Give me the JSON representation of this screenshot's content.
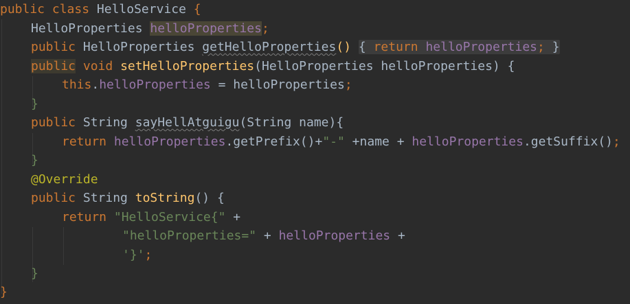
{
  "editor": {
    "class_decl": {
      "kw_public": "public",
      "kw_class": "class",
      "name": "HelloService",
      "brace_open": " {"
    },
    "field": {
      "type": "HelloProperties",
      "name": "helloProperties",
      "semi": ";"
    },
    "getter": {
      "kw_public": "public",
      "type": "HelloProperties",
      "name": "getHelloProperties",
      "parens": "()",
      "brace_open": "{",
      "kw_return": "return",
      "field": "helloProperties",
      "semi": ";",
      "brace_close": "}"
    },
    "setter": {
      "kw_public": "public",
      "kw_void": "void",
      "name": "setHelloProperties",
      "params": "(HelloProperties helloProperties) {",
      "kw_this": "this",
      "dot": ".",
      "field": "helloProperties",
      "assign": " = helloProperties",
      "semi": ";",
      "brace_close": "}"
    },
    "say": {
      "kw_public": "public",
      "type": "String",
      "name": "sayHellAtguigu",
      "params": "(String name){",
      "kw_return": "return",
      "field1": "helloProperties",
      "call1": ".getPrefix()+",
      "str_dash": "\"-\"",
      "mid": " +name + ",
      "field2": "helloProperties",
      "call2": ".getSuffix()",
      "semi": ";",
      "brace_close": "}"
    },
    "annotation": "@Override",
    "tostring": {
      "kw_public": "public",
      "type": "String",
      "name": "toString",
      "parens": "() {",
      "kw_return": "return",
      "str1": "\"HelloService{\"",
      "plus1": " +",
      "str2": "\"helloProperties=\"",
      "plus2": " + ",
      "field": "helloProperties",
      "plus3": " +",
      "str3": "'}'",
      "semi": ";",
      "brace_close": "}"
    },
    "class_close": "}"
  }
}
